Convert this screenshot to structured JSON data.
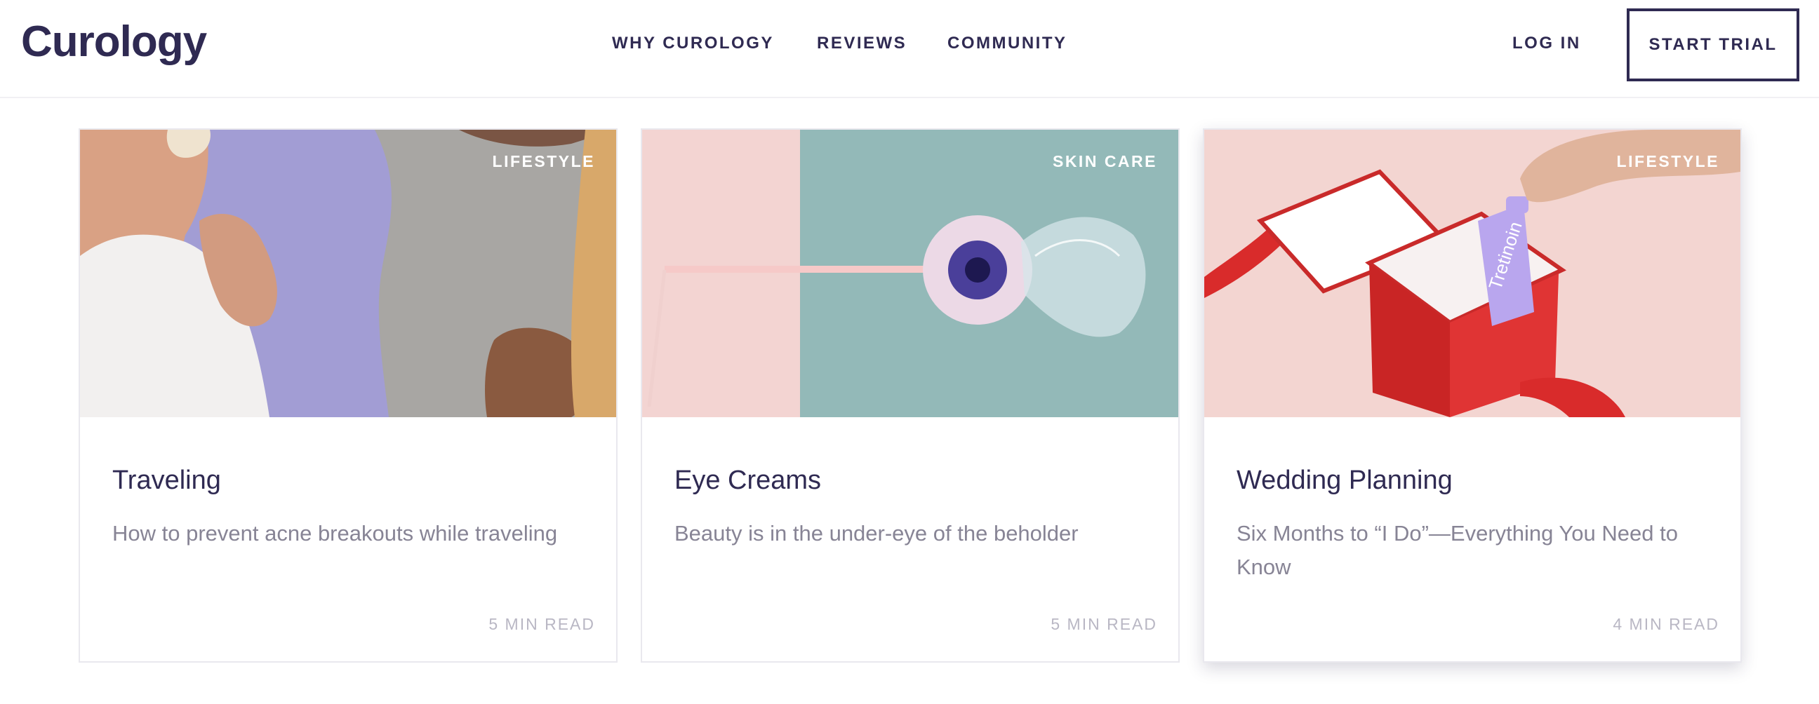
{
  "header": {
    "logo": "Curology",
    "nav": [
      "WHY CUROLOGY",
      "REVIEWS",
      "COMMUNITY"
    ],
    "login": "LOG IN",
    "cta": "START TRIAL"
  },
  "cards": [
    {
      "tag": "LIFESTYLE",
      "title": "Traveling",
      "subtitle": "How to prevent acne breakouts while traveling",
      "read_time": "5 MIN READ"
    },
    {
      "tag": "SKIN CARE",
      "title": "Eye Creams",
      "subtitle": "Beauty is in the under-eye of the beholder",
      "read_time": "5 MIN READ"
    },
    {
      "tag": "LIFESTYLE",
      "title": "Wedding Planning",
      "subtitle": "Six Months to “I Do”—Everything You Need to Know",
      "read_time": "4 MIN READ",
      "image_text": "Tretinoin"
    }
  ],
  "colors": {
    "brand": "#2f2a52",
    "muted": "#878495",
    "light": "#b9b7c4"
  }
}
